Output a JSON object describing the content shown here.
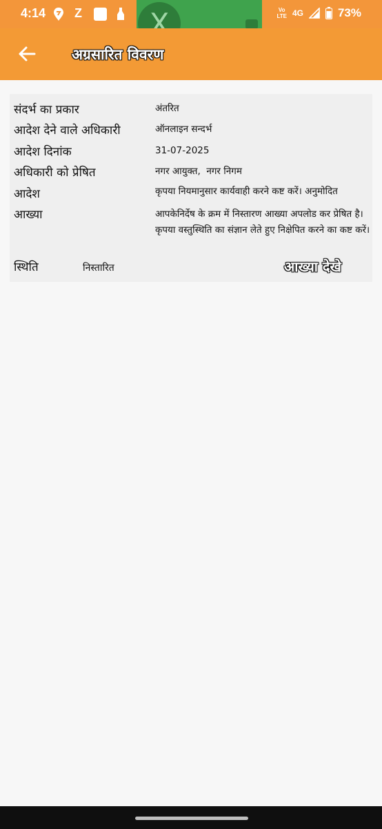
{
  "status_bar": {
    "time": "4:14",
    "icons": [
      "swiggy-icon",
      "zomato-icon",
      "app-square-icon",
      "notification-icon"
    ],
    "volte": "Vo\nLTE",
    "network": "4G",
    "battery": "73%"
  },
  "overlay": {
    "app": "X",
    "icon": "x-logo-icon"
  },
  "app_bar": {
    "title": "अग्रसारित विवरण",
    "back_icon": "arrow-left-icon"
  },
  "details": [
    {
      "label": "संदर्भ का प्रकार",
      "value": "अंतरित"
    },
    {
      "label": "आदेश देने वाले अधिकारी",
      "value": "ऑनलाइन सन्दर्भ"
    },
    {
      "label": "आदेश दिनांक",
      "value": "31-07-2025"
    },
    {
      "label": "अधिकारी को प्रेषित",
      "value": "नगर आयुक्त,  नगर निगम"
    },
    {
      "label": "आदेश",
      "value": "कृपया नियमानुसार कार्यवाही करने कष्ट करें। अनुमोदित"
    },
    {
      "label": "आख्या",
      "value": "आपकेनिर्देष के क्रम में निस्तारण आख्या अपलोड कर प्रेषित है। कृपया वस्तुस्थिति का संज्ञान लेते हुए निक्षेपित करने का कष्ट करें।"
    }
  ],
  "status": {
    "label": "स्थिति",
    "value": "निस्तारित",
    "view_button": "आख्या देखे"
  },
  "colors": {
    "app_bar": "#f39a35",
    "overlay": "#3fa34d",
    "background": "#f7f7f7",
    "card": "#efefef"
  }
}
